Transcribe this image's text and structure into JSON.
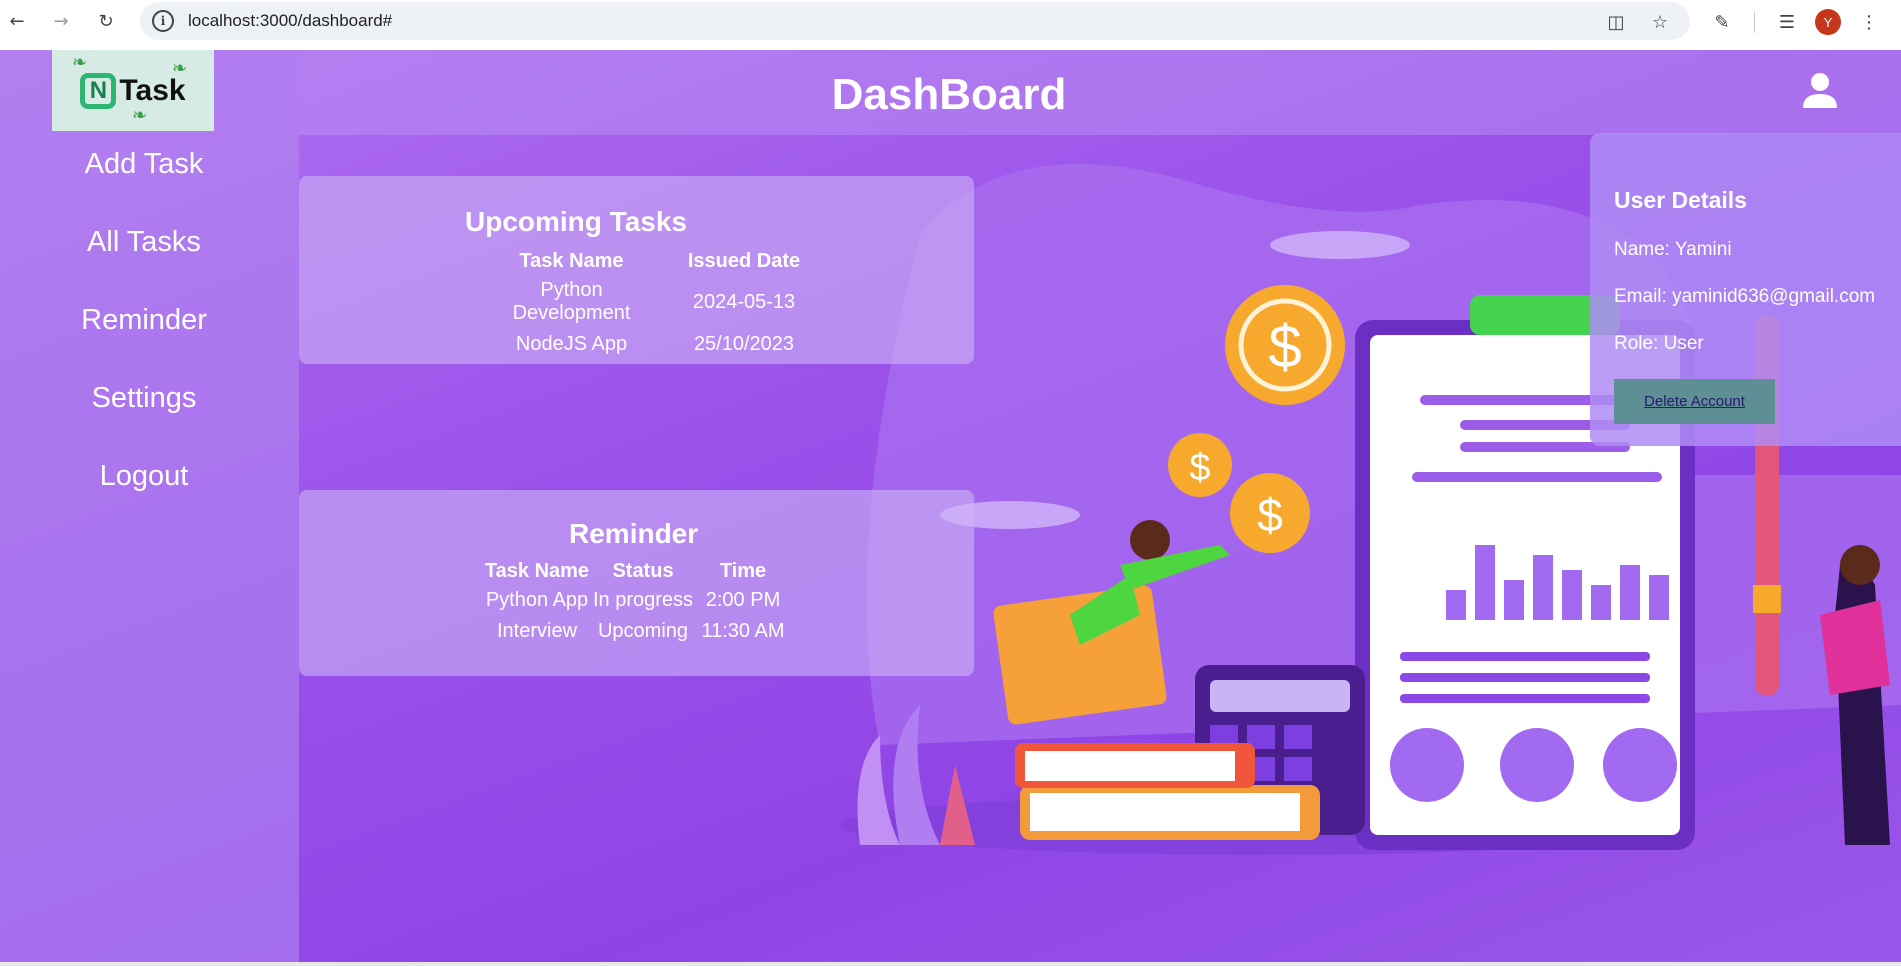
{
  "browser": {
    "url": "localhost:3000/dashboard#",
    "avatar_letter": "Y"
  },
  "app": {
    "logo_text": "Task",
    "logo_letter": "N",
    "title": "DashBoard"
  },
  "sidebar": {
    "items": [
      {
        "label": "Add Task"
      },
      {
        "label": "All Tasks"
      },
      {
        "label": "Reminder"
      },
      {
        "label": "Settings"
      },
      {
        "label": "Logout"
      }
    ]
  },
  "upcoming": {
    "title": "Upcoming Tasks",
    "headers": [
      "Task Name",
      "Issued Date"
    ],
    "rows": [
      [
        "Python Development",
        "2024-05-13"
      ],
      [
        "NodeJS App",
        "25/10/2023"
      ]
    ]
  },
  "reminder": {
    "title": "Reminder",
    "headers": [
      "Task Name",
      "Status",
      "Time"
    ],
    "rows": [
      [
        "Python App",
        "In progress",
        "2:00 PM"
      ],
      [
        "Interview",
        "Upcoming",
        "11:30 AM"
      ]
    ]
  },
  "user_details": {
    "title": "User Details",
    "name": "Name: Yamini",
    "email": "Email: yaminid636@gmail.com",
    "role": "Role: User",
    "delete_label": "Delete Account"
  },
  "colors": {
    "bg_purple": "#9a52ea",
    "delete_button": "#5d8f94"
  }
}
